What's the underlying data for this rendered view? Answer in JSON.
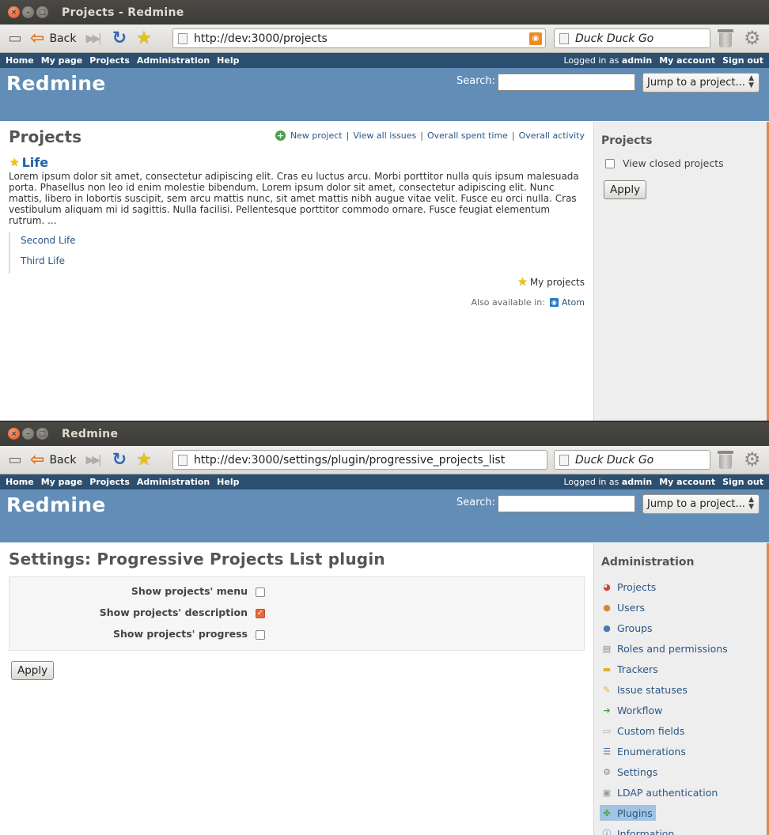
{
  "browser": {
    "back_label": "Back",
    "search_engine": "Duck Duck Go"
  },
  "redmine": {
    "menu": [
      "Home",
      "My page",
      "Projects",
      "Administration",
      "Help"
    ],
    "logged_in_prefix": "Logged in as",
    "user": "admin",
    "my_account": "My account",
    "sign_out": "Sign out",
    "app_title": "Redmine",
    "search_label": "Search:",
    "jump_label": "Jump to a project..."
  },
  "window1": {
    "title": "Projects - Redmine",
    "url": "http://dev:3000/projects",
    "page_title": "Projects",
    "actions": [
      "New project",
      "View all issues",
      "Overall spent time",
      "Overall activity"
    ],
    "project_name": "Life",
    "project_description": "Lorem ipsum dolor sit amet, consectetur adipiscing elit. Cras eu luctus arcu. Morbi porttitor nulla quis ipsum malesuada porta. Phasellus non leo id enim molestie bibendum. Lorem ipsum dolor sit amet, consectetur adipiscing elit. Nunc mattis, libero in lobortis suscipit, sem arcu mattis nunc, sit amet mattis nibh augue vitae velit. Fusce eu orci nulla. Cras vestibulum aliquam mi id sagittis. Nulla facilisi. Pellentesque porttitor commodo ornare. Fusce feugiat elementum rutrum. ...",
    "subprojects": [
      "Second Life",
      "Third Life"
    ],
    "my_projects_label": "My projects",
    "also_available": "Also available in:",
    "atom_label": "Atom",
    "sidebar": {
      "title": "Projects",
      "view_closed": "View closed projects",
      "apply": "Apply"
    }
  },
  "window2": {
    "title": "Redmine",
    "url": "http://dev:3000/settings/plugin/progressive_projects_list",
    "page_title": "Settings: Progressive Projects List plugin",
    "options": [
      {
        "label": "Show projects' menu",
        "checked": false
      },
      {
        "label": "Show projects' description",
        "checked": true
      },
      {
        "label": "Show projects' progress",
        "checked": false
      }
    ],
    "apply": "Apply",
    "sidebar": {
      "title": "Administration",
      "items": [
        {
          "label": "Projects",
          "icon": "projects-icon"
        },
        {
          "label": "Users",
          "icon": "users-icon"
        },
        {
          "label": "Groups",
          "icon": "groups-icon"
        },
        {
          "label": "Roles and permissions",
          "icon": "roles-icon"
        },
        {
          "label": "Trackers",
          "icon": "trackers-icon"
        },
        {
          "label": "Issue statuses",
          "icon": "issue-statuses-icon"
        },
        {
          "label": "Workflow",
          "icon": "workflow-icon"
        },
        {
          "label": "Custom fields",
          "icon": "custom-fields-icon"
        },
        {
          "label": "Enumerations",
          "icon": "enumerations-icon"
        },
        {
          "label": "Settings",
          "icon": "settings-icon"
        },
        {
          "label": "LDAP authentication",
          "icon": "ldap-icon"
        },
        {
          "label": "Plugins",
          "icon": "plugins-icon",
          "selected": true
        },
        {
          "label": "Information",
          "icon": "information-icon"
        }
      ]
    }
  },
  "colors": {
    "top_menu": "#2c4e6f",
    "header": "#628db6",
    "link": "#2a5685",
    "sidebar_bg": "#eeeeee",
    "selected_bg": "#a1c4e2"
  }
}
